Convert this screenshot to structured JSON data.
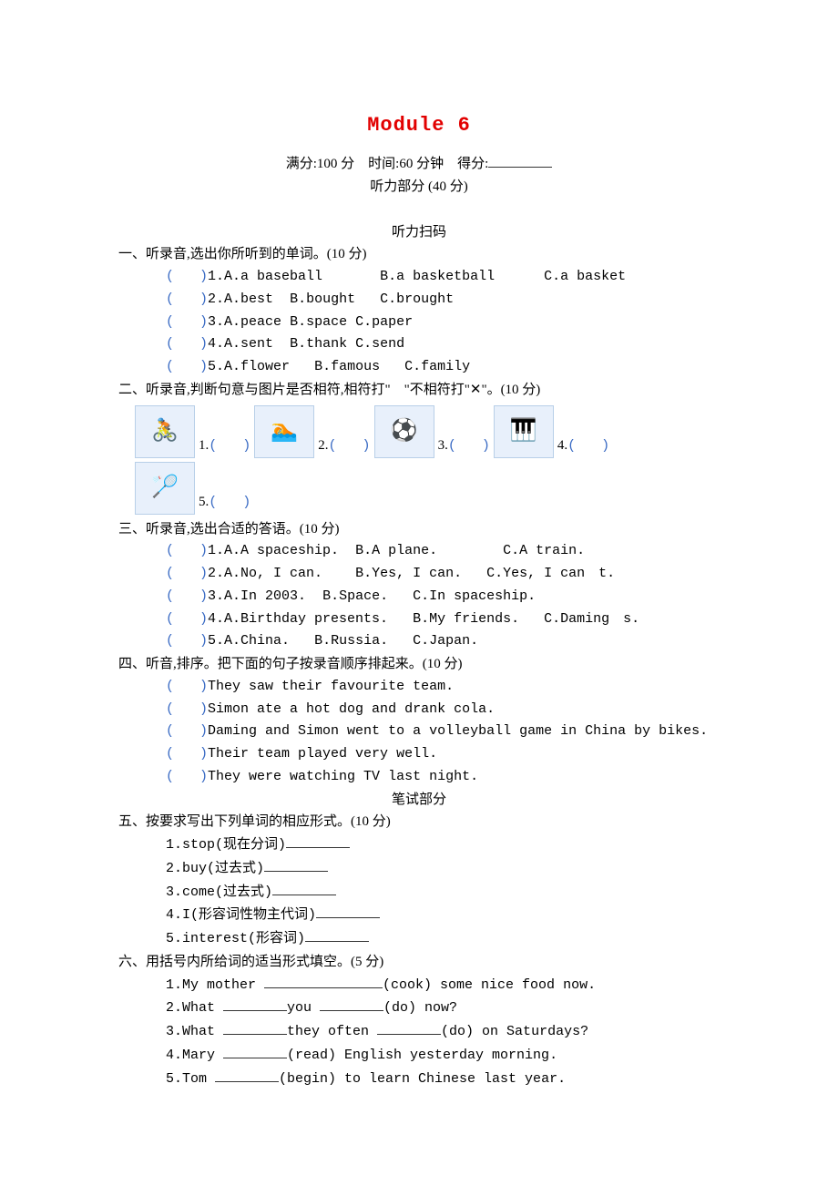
{
  "title": "Module 6",
  "header": {
    "full_text": "满分:100 分　时间:60 分钟　得分:",
    "listening_title": "听力部分 (40 分)",
    "scan_title": "听力扫码"
  },
  "q1": {
    "heading": "一、听录音,选出你所听到的单词。(10 分)",
    "items": [
      [
        "1.A.a baseball",
        "B.a basketball",
        "C.a basket"
      ],
      [
        "2.A.best",
        "B.bought",
        "C.brought"
      ],
      [
        "3.A.peace",
        "B.space",
        "C.paper"
      ],
      [
        "4.A.sent",
        "B.thank",
        "C.send"
      ],
      [
        "5.A.flower",
        "B.famous",
        "C.family"
      ]
    ]
  },
  "q2": {
    "heading": "二、听录音,判断句意与图片是否相符,相符打\"　\"不相符打\"✕\"。(10 分)",
    "icons": [
      "🚴",
      "🏊",
      "⚽",
      "🎹",
      "🏸"
    ]
  },
  "q3": {
    "heading": "三、听录音,选出合适的答语。(10 分)",
    "items": [
      [
        "1.A.A spaceship.",
        "B.A plane.",
        "C.A train."
      ],
      [
        "2.A.No, I can.",
        "B.Yes, I can.",
        "C.Yes, I can　t."
      ],
      [
        "3.A.In 2003.",
        "B.Space.",
        "C.In spaceship."
      ],
      [
        "4.A.Birthday presents.",
        "B.My friends.",
        "C.Daming　s."
      ],
      [
        "5.A.China.",
        "B.Russia.",
        "C.Japan."
      ]
    ]
  },
  "q4": {
    "heading": "四、听音,排序。把下面的句子按录音顺序排起来。(10 分)",
    "items": [
      "They saw their favourite team.",
      "Simon ate a hot dog and drank cola.",
      "Daming and Simon went to a volleyball game in China by bikes.",
      "Their team played very well.",
      "They were watching TV last night."
    ]
  },
  "written_title": "笔试部分",
  "q5": {
    "heading": "五、按要求写出下列单词的相应形式。(10 分)",
    "items": [
      "1.stop(现在分词)",
      "2.buy(过去式)",
      "3.come(过去式)",
      "4.I(形容词性物主代词)",
      "5.interest(形容词)"
    ]
  },
  "q6": {
    "heading": "六、用括号内所给词的适当形式填空。(5 分)",
    "items": [
      "1.My mother ",
      "2.What ",
      "3.What ",
      "4.Mary ",
      "5.Tom "
    ]
  }
}
